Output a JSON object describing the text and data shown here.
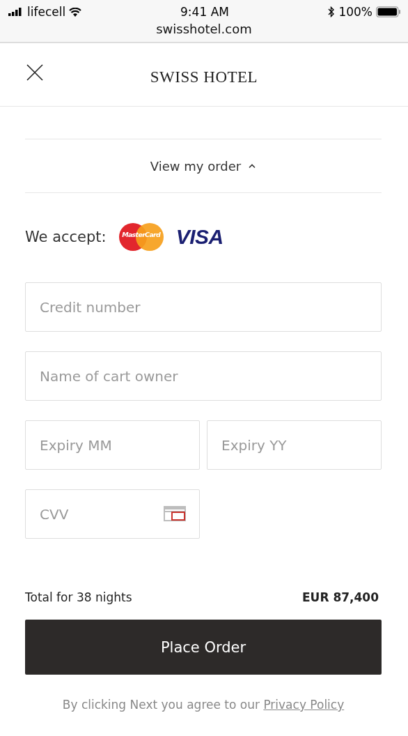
{
  "status_bar": {
    "carrier": "lifecell",
    "time": "9:41 AM",
    "battery": "100%"
  },
  "address_bar": {
    "url": "swisshotel.com"
  },
  "header": {
    "title": "SWISS HOTEL"
  },
  "order_toggle": {
    "label": "View my order",
    "expanded": true
  },
  "accepted_cards": {
    "label": "We accept:",
    "cards": [
      {
        "kind": "mastercard",
        "text": "MasterCard"
      },
      {
        "kind": "visa",
        "text": "VISA"
      }
    ]
  },
  "fields": [
    {
      "placeholder": "Credit number",
      "kind": "full"
    },
    {
      "placeholder": "Name of cart owner",
      "kind": "full"
    },
    {
      "placeholder": "Expiry MM",
      "kind": "half"
    },
    {
      "placeholder": "Expiry YY",
      "kind": "half"
    },
    {
      "placeholder": "CVV",
      "kind": "cvv"
    }
  ],
  "total": {
    "label": "Total for 38 nights",
    "amount": "EUR 87,400"
  },
  "place_order_button": "Place Order",
  "footer": {
    "text": "By clicking Next you agree to our",
    "link": "Privacy Policy"
  }
}
